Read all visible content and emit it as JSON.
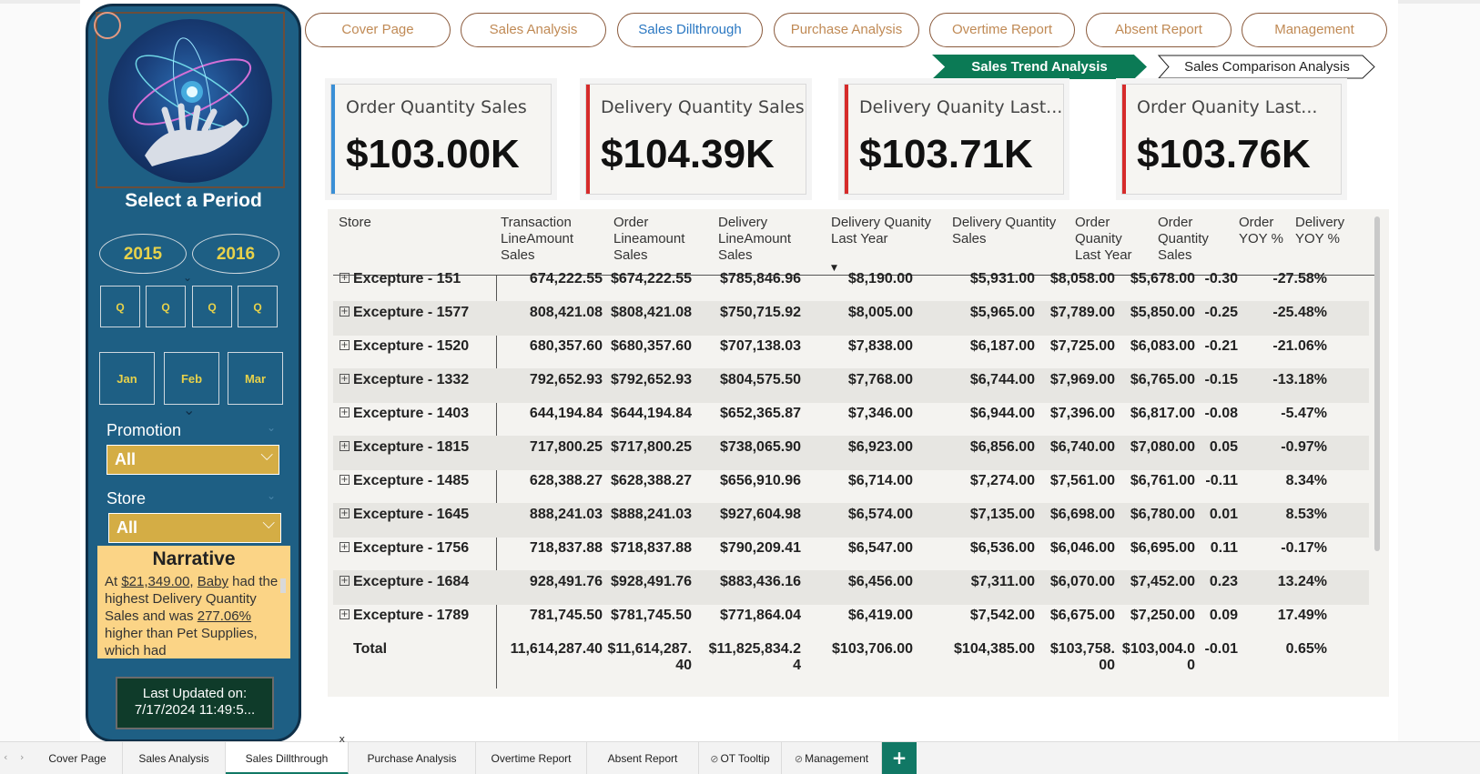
{
  "left_panel": {
    "select_period_label": "Select a Period",
    "years": [
      "2015",
      "2016"
    ],
    "quarters": [
      "Q",
      "Q",
      "Q",
      "Q"
    ],
    "months": [
      "Jan",
      "Feb",
      "Mar"
    ],
    "promotion": {
      "title": "Promotion",
      "value": "All"
    },
    "store": {
      "title": "Store",
      "value": "All"
    },
    "narrative": {
      "title": "Narrative",
      "p1": "At ",
      "amount": "$21,349.00",
      "p2": ", ",
      "item": "Baby",
      "p3": " had the highest Delivery Quantity Sales and was ",
      "percent": "277.06%",
      "p4": " higher than Pet Supplies, which had"
    },
    "last_updated": {
      "line1": "Last Updated on:",
      "line2": "7/17/2024 11:49:5..."
    }
  },
  "nav_buttons": [
    {
      "label": "Cover Page",
      "active": false
    },
    {
      "label": "Sales Analysis",
      "active": false
    },
    {
      "label": "Sales Dillthrough",
      "active": true
    },
    {
      "label": "Purchase Analysis",
      "active": false
    },
    {
      "label": "Overtime Report",
      "active": false
    },
    {
      "label": "Absent Report",
      "active": false
    },
    {
      "label": "Management",
      "active": false
    }
  ],
  "sub_tabs": {
    "active": "Sales Trend Analysis",
    "inactive": "Sales Comparison Analysis"
  },
  "kpis": [
    {
      "title": "Order Quantity Sales",
      "value": "$103.00K",
      "accent": "#3a8fd6"
    },
    {
      "title": "Delivery Quantity Sales",
      "value": "$104.39K",
      "accent": "#d62b2b"
    },
    {
      "title": "Delivery Quanity Last...",
      "value": "$103.71K",
      "accent": "#d62b2b"
    },
    {
      "title": "Order Quanity Last...",
      "value": "$103.76K",
      "accent": "#d62b2b"
    }
  ],
  "table": {
    "headers": {
      "store": "Store",
      "tla": "Transaction LineAmount Sales",
      "ola": "Order Lineamount Sales",
      "dla": "Delivery LineAmount Sales",
      "dqly": "Delivery Quanity Last Year",
      "dqs": "Delivery Quantity Sales",
      "oqly": "Order Quanity Last Year",
      "oqs": "Order Quantity Sales",
      "oyoy": "Order YOY %",
      "dyoy": "Delivery YOY %"
    },
    "rows": [
      {
        "store": "Excepture - 151",
        "tla": "674,222.55",
        "ola": "$674,222.55",
        "dla": "$785,846.96",
        "dqly": "$8,190.00",
        "dqs": "$5,931.00",
        "oqly": "$8,058.00",
        "oqs": "$5,678.00",
        "oyoy": "-0.30",
        "dyoy": "-27.58%"
      },
      {
        "store": "Excepture - 1577",
        "tla": "808,421.08",
        "ola": "$808,421.08",
        "dla": "$750,715.92",
        "dqly": "$8,005.00",
        "dqs": "$5,965.00",
        "oqly": "$7,789.00",
        "oqs": "$5,850.00",
        "oyoy": "-0.25",
        "dyoy": "-25.48%"
      },
      {
        "store": "Excepture - 1520",
        "tla": "680,357.60",
        "ola": "$680,357.60",
        "dla": "$707,138.03",
        "dqly": "$7,838.00",
        "dqs": "$6,187.00",
        "oqly": "$7,725.00",
        "oqs": "$6,083.00",
        "oyoy": "-0.21",
        "dyoy": "-21.06%"
      },
      {
        "store": "Excepture - 1332",
        "tla": "792,652.93",
        "ola": "$792,652.93",
        "dla": "$804,575.50",
        "dqly": "$7,768.00",
        "dqs": "$6,744.00",
        "oqly": "$7,969.00",
        "oqs": "$6,765.00",
        "oyoy": "-0.15",
        "dyoy": "-13.18%"
      },
      {
        "store": "Excepture - 1403",
        "tla": "644,194.84",
        "ola": "$644,194.84",
        "dla": "$652,365.87",
        "dqly": "$7,346.00",
        "dqs": "$6,944.00",
        "oqly": "$7,396.00",
        "oqs": "$6,817.00",
        "oyoy": "-0.08",
        "dyoy": "-5.47%"
      },
      {
        "store": "Excepture - 1815",
        "tla": "717,800.25",
        "ola": "$717,800.25",
        "dla": "$738,065.90",
        "dqly": "$6,923.00",
        "dqs": "$6,856.00",
        "oqly": "$6,740.00",
        "oqs": "$7,080.00",
        "oyoy": "0.05",
        "dyoy": "-0.97%"
      },
      {
        "store": "Excepture - 1485",
        "tla": "628,388.27",
        "ola": "$628,388.27",
        "dla": "$656,910.96",
        "dqly": "$6,714.00",
        "dqs": "$7,274.00",
        "oqly": "$7,561.00",
        "oqs": "$6,761.00",
        "oyoy": "-0.11",
        "dyoy": "8.34%"
      },
      {
        "store": "Excepture - 1645",
        "tla": "888,241.03",
        "ola": "$888,241.03",
        "dla": "$927,604.98",
        "dqly": "$6,574.00",
        "dqs": "$7,135.00",
        "oqly": "$6,698.00",
        "oqs": "$6,780.00",
        "oyoy": "0.01",
        "dyoy": "8.53%"
      },
      {
        "store": "Excepture - 1756",
        "tla": "718,837.88",
        "ola": "$718,837.88",
        "dla": "$790,209.41",
        "dqly": "$6,547.00",
        "dqs": "$6,536.00",
        "oqly": "$6,046.00",
        "oqs": "$6,695.00",
        "oyoy": "0.11",
        "dyoy": "-0.17%"
      },
      {
        "store": "Excepture - 1684",
        "tla": "928,491.76",
        "ola": "$928,491.76",
        "dla": "$883,436.16",
        "dqly": "$6,456.00",
        "dqs": "$7,311.00",
        "oqly": "$6,070.00",
        "oqs": "$7,452.00",
        "oyoy": "0.23",
        "dyoy": "13.24%"
      },
      {
        "store": "Excepture - 1789",
        "tla": "781,745.50",
        "ola": "$781,745.50",
        "dla": "$771,864.04",
        "dqly": "$6,419.00",
        "dqs": "$7,542.00",
        "oqly": "$6,675.00",
        "oqs": "$7,250.00",
        "oyoy": "0.09",
        "dyoy": "17.49%"
      }
    ],
    "total": {
      "store": "Total",
      "tla": "11,614,287.40",
      "ola": "$11,614,287.40",
      "dla": "$11,825,834.24",
      "dqly": "$103,706.00",
      "dqs": "$104,385.00",
      "oqly": "$103,758.00",
      "oqs": "$103,004.00",
      "oyoy": "-0.01",
      "dyoy": "0.65%"
    }
  },
  "bottom_tabs": [
    {
      "label": "Cover Page",
      "active": false,
      "hidden": false
    },
    {
      "label": "Sales Analysis",
      "active": false,
      "hidden": false
    },
    {
      "label": "Sales Dillthrough",
      "active": true,
      "hidden": false
    },
    {
      "label": "Purchase Analysis",
      "active": false,
      "hidden": false
    },
    {
      "label": "Overtime Report",
      "active": false,
      "hidden": false
    },
    {
      "label": "Absent Report",
      "active": false,
      "hidden": false
    },
    {
      "label": "OT Tooltip",
      "active": false,
      "hidden": true
    },
    {
      "label": "Management",
      "active": false,
      "hidden": true
    }
  ],
  "add_tab_label": "+",
  "close_tab_label": "x"
}
